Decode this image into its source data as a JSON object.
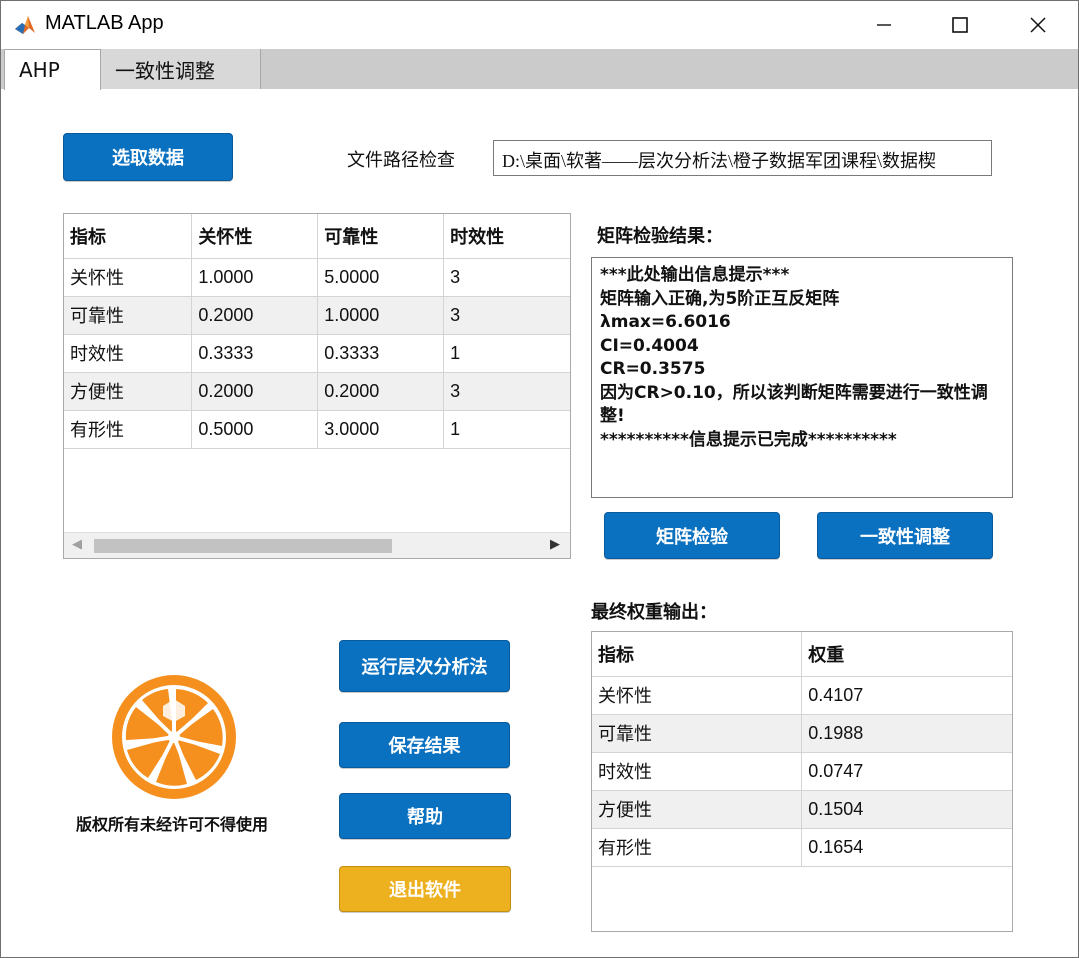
{
  "window": {
    "title": "MATLAB App",
    "minimize_glyph": "—",
    "maximize_glyph": "☐",
    "close_glyph": "✕"
  },
  "tabs": [
    {
      "label": "AHP",
      "selected": true
    },
    {
      "label": "一致性调整",
      "selected": false
    }
  ],
  "top": {
    "select_data_button": "选取数据",
    "path_check_label": "文件路径检查",
    "path_value": "D:\\桌面\\软著——层次分析法\\橙子数据军团课程\\数据楔"
  },
  "matrix_table": {
    "headers": [
      "指标",
      "关怀性",
      "可靠性",
      "时效性"
    ],
    "rows": [
      [
        "关怀性",
        "1.0000",
        "5.0000",
        "3"
      ],
      [
        "可靠性",
        "0.2000",
        "1.0000",
        "3"
      ],
      [
        "时效性",
        "0.3333",
        "0.3333",
        "1"
      ],
      [
        "方便性",
        "0.2000",
        "0.2000",
        "3"
      ],
      [
        "有形性",
        "0.5000",
        "3.0000",
        "1"
      ]
    ],
    "scroll_left": "◀",
    "scroll_right": "▶"
  },
  "check_result": {
    "label": "矩阵检验结果：",
    "lines": [
      "***此处输出信息提示***",
      "矩阵输入正确,为5阶正互反矩阵",
      "λmax=6.6016",
      "CI=0.4004",
      "CR=0.3575",
      "因为CR>0.10，所以该判断矩阵需要进行一致性调整!",
      "**********信息提示已完成**********"
    ],
    "matrix_check_button": "矩阵检验",
    "consistency_adjust_button": "一致性调整"
  },
  "actions": {
    "run_ahp": "运行层次分析法",
    "save_result": "保存结果",
    "help": "帮助",
    "exit": "退出软件"
  },
  "logo": {
    "icon": "orange-slice-icon",
    "copyright": "版权所有未经许可不得使用"
  },
  "weights": {
    "label": "最终权重输出：",
    "headers": [
      "指标",
      "权重"
    ],
    "rows": [
      [
        "关怀性",
        "0.4107"
      ],
      [
        "可靠性",
        "0.1988"
      ],
      [
        "时效性",
        "0.0747"
      ],
      [
        "方便性",
        "0.1504"
      ],
      [
        "有形性",
        "0.1654"
      ]
    ]
  },
  "colors": {
    "button_blue": "#0a70c0",
    "button_yellow": "#edb120",
    "tabbar_gray": "#cbcbcb",
    "orange": "#f5901e"
  }
}
